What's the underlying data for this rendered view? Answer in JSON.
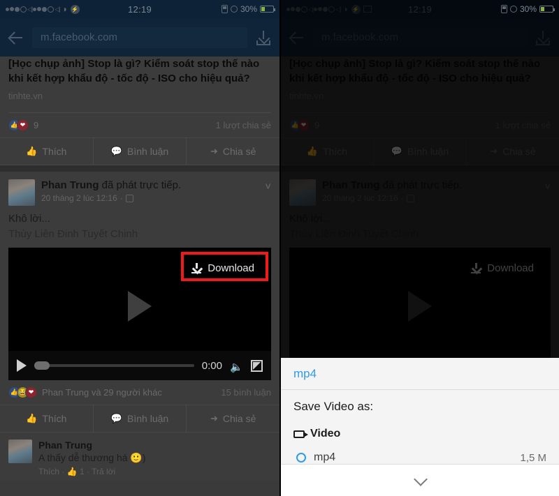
{
  "status_bar": {
    "time": "12:19",
    "battery": "30%",
    "icons_left": [
      "notification-dots",
      "sim-signal",
      "wifi-icon",
      "messenger-icon"
    ],
    "icons_left_right_panel": [
      "notification-dots",
      "sim-signal",
      "wifi-icon",
      "messenger-icon",
      "image-icon"
    ],
    "icons_right": [
      "vibrate-icon",
      "alarm-icon",
      "battery-icon"
    ]
  },
  "browser": {
    "url": "m.facebook.com",
    "back_label": "Back",
    "download_label": "Download"
  },
  "link_post": {
    "headline_line1": "[Học chụp ảnh] Stop là gì? Kiểm soát stop thế nào",
    "headline_line2": "khi kết hợp khẩu độ - tốc độ - ISO cho hiệu quả?",
    "source": "tinhte.vn",
    "reaction_count": "9",
    "share_count": "1 lượt chia sẻ"
  },
  "actions": {
    "like": "Thích",
    "comment": "Bình luận",
    "share": "Chia sẻ"
  },
  "video_post": {
    "author": "Phan Trung",
    "action_text": "đã phát trực tiếp.",
    "timestamp": "20 tháng 2 lúc 12:16",
    "text_line1": "Khô lời...",
    "text_line2": "Thùy Liên Đinh Tuyết Chinh",
    "download_button": "Download",
    "video_time": "0:00",
    "reaction_names": "Phan Trung và 29 người khác",
    "comment_count": "15 bình luận"
  },
  "comment": {
    "author": "Phan Trung",
    "text": "A thấy dễ thương há 🙂)",
    "meta": "Thích · 👍 1 · Trả lời"
  },
  "sheet": {
    "title": "mp4",
    "heading": "Save Video as:",
    "group_label": "Video",
    "option_label": "mp4",
    "option_size": "1,5 M",
    "collapse_label": "Collapse"
  },
  "colors": {
    "highlight": "#ef1b1b",
    "accent_blue": "#2e9bf0",
    "browser_bar": "#0f2438"
  }
}
